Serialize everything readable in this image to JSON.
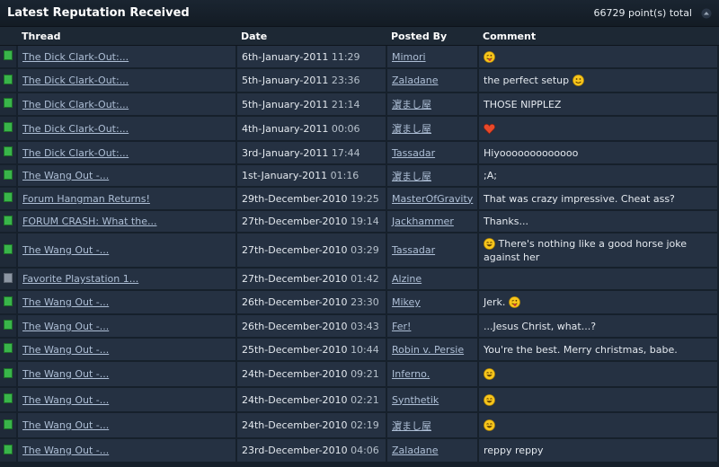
{
  "header": {
    "title": "Latest Reputation Received",
    "total": "66729 point(s) total"
  },
  "columns": {
    "thread": "Thread",
    "date": "Date",
    "posted_by": "Posted By",
    "comment": "Comment"
  },
  "rows": [
    {
      "indicator": "green",
      "thread": "The Dick Clark-Out:...",
      "date": "6th-January-2011",
      "time": "11:29",
      "user": "Mimori",
      "comment": "",
      "comment_icon": "tongue-smiley-icon",
      "icon_pos": "only"
    },
    {
      "indicator": "green",
      "thread": "The Dick Clark-Out:...",
      "date": "5th-January-2011",
      "time": "23:36",
      "user": "Zaladane",
      "comment": "the perfect setup",
      "comment_icon": "smile-smiley-icon",
      "icon_pos": "after"
    },
    {
      "indicator": "green",
      "thread": "The Dick Clark-Out:...",
      "date": "5th-January-2011",
      "time": "21:14",
      "user": "濵まし屋",
      "comment": "THOSE NIPPLEZ",
      "comment_icon": "",
      "icon_pos": ""
    },
    {
      "indicator": "green",
      "thread": "The Dick Clark-Out:...",
      "date": "4th-January-2011",
      "time": "00:06",
      "user": "濵まし屋",
      "comment": "",
      "comment_icon": "heart-icon",
      "icon_pos": "only"
    },
    {
      "indicator": "green",
      "thread": "The Dick Clark-Out:...",
      "date": "3rd-January-2011",
      "time": "17:44",
      "user": "Tassadar",
      "comment": "Hiyooooooooooooo",
      "comment_icon": "",
      "icon_pos": ""
    },
    {
      "indicator": "green",
      "thread": "The Wang Out -...",
      "date": "1st-January-2011",
      "time": "01:16",
      "user": "濵まし屋",
      "comment": ";A;",
      "comment_icon": "",
      "icon_pos": ""
    },
    {
      "indicator": "green",
      "thread": "Forum Hangman Returns!",
      "date": "29th-December-2010",
      "time": "19:25",
      "user": "MasterOfGravity",
      "comment": "That was crazy impressive. Cheat ass?",
      "comment_icon": "",
      "icon_pos": ""
    },
    {
      "indicator": "green",
      "thread": "FORUM CRASH: What the...",
      "date": "27th-December-2010",
      "time": "19:14",
      "user": "Jackhammer",
      "comment": "Thanks...",
      "comment_icon": "",
      "icon_pos": ""
    },
    {
      "indicator": "green",
      "thread": "The Wang Out -...",
      "date": "27th-December-2010",
      "time": "03:29",
      "user": "Tassadar",
      "comment": "There's nothing like a good horse joke against her",
      "comment_icon": "laugh-smiley-icon",
      "icon_pos": "before"
    },
    {
      "indicator": "gray",
      "thread": "Favorite Playstation 1...",
      "date": "27th-December-2010",
      "time": "01:42",
      "user": "Alzine",
      "comment": "",
      "comment_icon": "",
      "icon_pos": ""
    },
    {
      "indicator": "green",
      "thread": "The Wang Out -...",
      "date": "26th-December-2010",
      "time": "23:30",
      "user": "Mikey",
      "comment": "Jerk.",
      "comment_icon": "tongue-smiley-icon",
      "icon_pos": "after"
    },
    {
      "indicator": "green",
      "thread": "The Wang Out -...",
      "date": "26th-December-2010",
      "time": "03:43",
      "user": "Fer!",
      "comment": "...Jesus Christ, what...?",
      "comment_icon": "",
      "icon_pos": ""
    },
    {
      "indicator": "green",
      "thread": "The Wang Out -...",
      "date": "25th-December-2010",
      "time": "10:44",
      "user": "Robin v. Persie",
      "comment": "You're the best. Merry christmas, babe.",
      "comment_icon": "",
      "icon_pos": ""
    },
    {
      "indicator": "green",
      "thread": "The Wang Out -...",
      "date": "24th-December-2010",
      "time": "09:21",
      "user": "Inferno.",
      "comment": "",
      "comment_icon": "laugh-smiley-icon",
      "icon_pos": "only"
    },
    {
      "indicator": "green",
      "thread": "The Wang Out -...",
      "date": "24th-December-2010",
      "time": "02:21",
      "user": "Synthetik",
      "comment": "",
      "comment_icon": "laugh-smiley-icon",
      "icon_pos": "only"
    },
    {
      "indicator": "green",
      "thread": "The Wang Out -...",
      "date": "24th-December-2010",
      "time": "02:19",
      "user": "濵まし屋",
      "comment": "",
      "comment_icon": "laugh-smiley-icon",
      "icon_pos": "only"
    },
    {
      "indicator": "green",
      "thread": "The Wang Out -...",
      "date": "23rd-December-2010",
      "time": "04:06",
      "user": "Zaladane",
      "comment": "reppy reppy",
      "comment_icon": "",
      "icon_pos": ""
    }
  ]
}
